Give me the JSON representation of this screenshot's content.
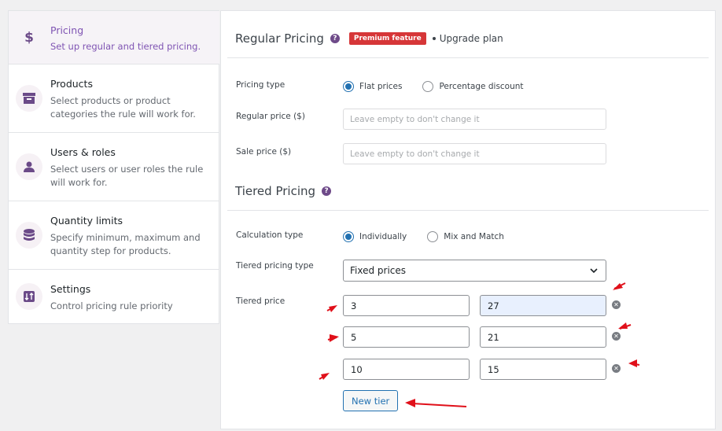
{
  "sidebar": {
    "items": [
      {
        "title": "Pricing",
        "desc": "Set up regular and tiered pricing.",
        "icon": "dollar-icon"
      },
      {
        "title": "Products",
        "desc": "Select products or product categories the rule will work for.",
        "icon": "box-icon"
      },
      {
        "title": "Users & roles",
        "desc": "Select users or user roles the rule will work for.",
        "icon": "user-icon"
      },
      {
        "title": "Quantity limits",
        "desc": "Specify minimum, maximum and quantity step for products.",
        "icon": "database-icon"
      },
      {
        "title": "Settings",
        "desc": "Control pricing rule priority",
        "icon": "sort-icon"
      }
    ]
  },
  "regular": {
    "title": "Regular Pricing",
    "badge": "Premium feature",
    "upgrade": "Upgrade plan",
    "pricing_type_label": "Pricing type",
    "options": [
      "Flat prices",
      "Percentage discount"
    ],
    "regular_price_label": "Regular price ($)",
    "sale_price_label": "Sale price ($)",
    "placeholder": "Leave empty to don't change it"
  },
  "tiered": {
    "title": "Tiered Pricing",
    "calc_label": "Calculation type",
    "calc_options": [
      "Individually",
      "Mix and Match"
    ],
    "type_label": "Tiered pricing type",
    "type_value": "Fixed prices",
    "price_label": "Tiered price",
    "tiers": [
      {
        "qty": "3",
        "price": "27"
      },
      {
        "qty": "5",
        "price": "21"
      },
      {
        "qty": "10",
        "price": "15"
      }
    ],
    "new_tier": "New tier"
  },
  "colors": {
    "accent": "#7f54b3",
    "link": "#2271b1",
    "badge": "#d63638",
    "annotation": "#e0101a"
  }
}
